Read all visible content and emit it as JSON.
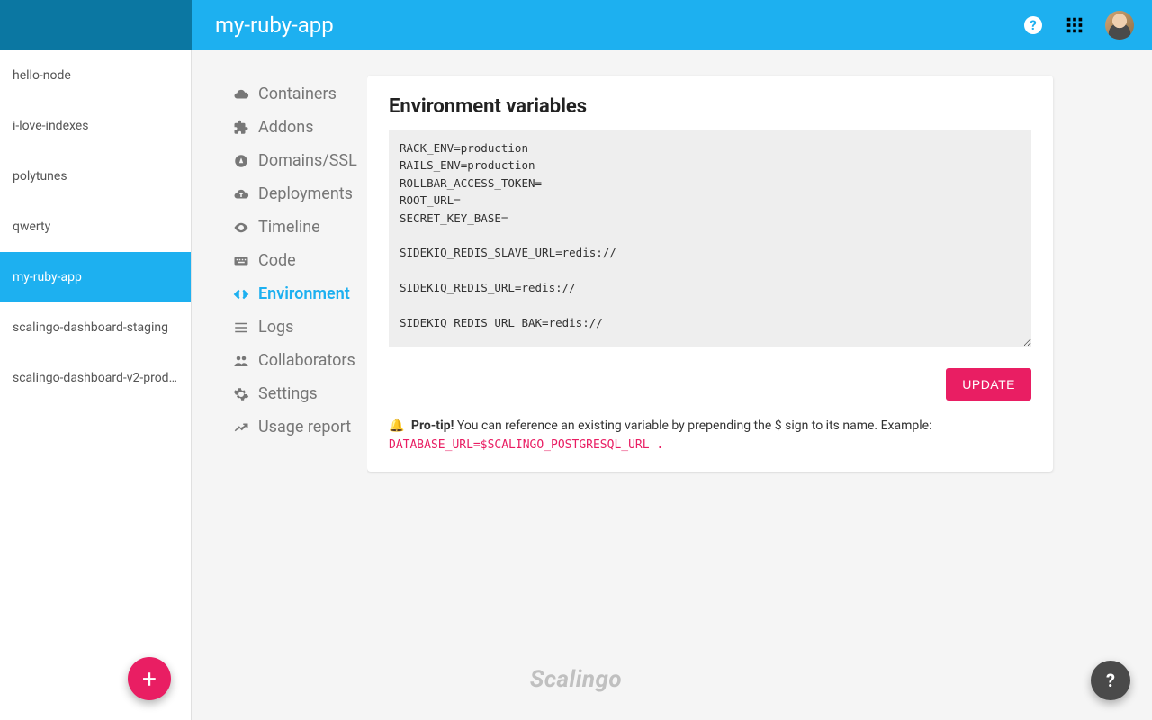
{
  "header": {
    "app_title": "my-ruby-app"
  },
  "apps": [
    {
      "name": "hello-node",
      "active": false
    },
    {
      "name": "i-love-indexes",
      "active": false
    },
    {
      "name": "polytunes",
      "active": false
    },
    {
      "name": "qwerty",
      "active": false
    },
    {
      "name": "my-ruby-app",
      "active": true
    },
    {
      "name": "scalingo-dashboard-staging",
      "active": false
    },
    {
      "name": "scalingo-dashboard-v2-produ…",
      "active": false
    }
  ],
  "subnav": [
    {
      "label": "Containers",
      "icon": "cloud-icon",
      "active": false
    },
    {
      "label": "Addons",
      "icon": "puzzle-icon",
      "active": false
    },
    {
      "label": "Domains/SSL",
      "icon": "compass-icon",
      "active": false
    },
    {
      "label": "Deployments",
      "icon": "cloud-upload-icon",
      "active": false
    },
    {
      "label": "Timeline",
      "icon": "eye-icon",
      "active": false
    },
    {
      "label": "Code",
      "icon": "keyboard-icon",
      "active": false
    },
    {
      "label": "Environment",
      "icon": "code-brackets-icon",
      "active": true
    },
    {
      "label": "Logs",
      "icon": "list-icon",
      "active": false
    },
    {
      "label": "Collaborators",
      "icon": "people-icon",
      "active": false
    },
    {
      "label": "Settings",
      "icon": "gear-icon",
      "active": false
    },
    {
      "label": "Usage report",
      "icon": "chart-icon",
      "active": false
    }
  ],
  "env": {
    "title": "Environment variables",
    "update_label": "UPDATE",
    "vars_text": "RACK_ENV=production\nRAILS_ENV=production\nROLLBAR_ACCESS_TOKEN=\nROOT_URL=\nSECRET_KEY_BASE=\n\nSIDEKIQ_REDIS_SLAVE_URL=redis://\n\nSIDEKIQ_REDIS_URL=redis://\n\nSIDEKIQ_REDIS_URL_BAK=redis://",
    "protip_label": "Pro-tip!",
    "protip_text": " You can reference an existing variable by prepending the $ sign to its name. Example:",
    "protip_code": "DATABASE_URL=$SCALINGO_POSTGRESQL_URL ."
  },
  "footer_brand": "Scalingo",
  "fab_label": "+",
  "help_label": "?"
}
